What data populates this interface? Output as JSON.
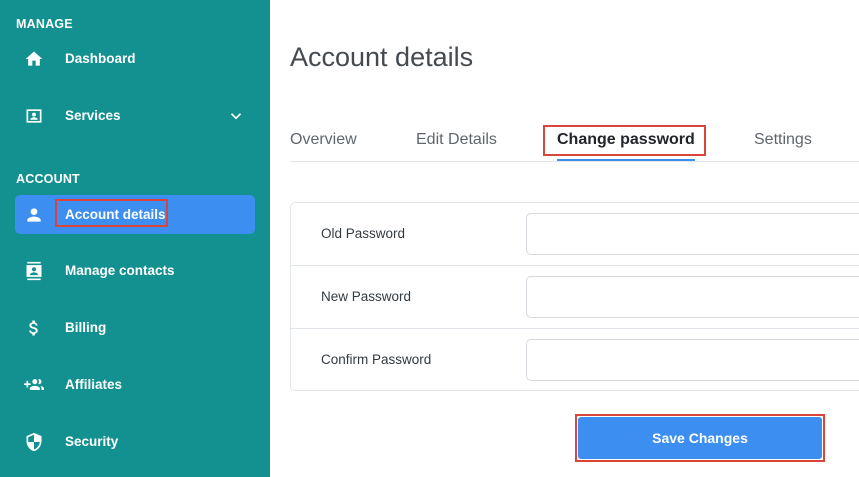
{
  "sidebar": {
    "manage_label": "MANAGE",
    "account_label": "ACCOUNT",
    "items": [
      {
        "label": "Dashboard",
        "icon": "home-icon"
      },
      {
        "label": "Services",
        "icon": "contact-card-icon"
      },
      {
        "label": "Account details",
        "icon": "person-icon"
      },
      {
        "label": "Manage contacts",
        "icon": "contacts-icon"
      },
      {
        "label": "Billing",
        "icon": "dollar-icon"
      },
      {
        "label": "Affiliates",
        "icon": "add-group-icon"
      },
      {
        "label": "Security",
        "icon": "shield-icon"
      }
    ],
    "active_item": "Account details"
  },
  "main": {
    "title": "Account details",
    "tabs": [
      {
        "label": "Overview"
      },
      {
        "label": "Edit Details"
      },
      {
        "label": "Change password"
      },
      {
        "label": "Settings"
      }
    ],
    "active_tab": "Change password",
    "form": {
      "fields": [
        {
          "label": "Old Password",
          "value": "",
          "placeholder": ""
        },
        {
          "label": "New Password",
          "value": "",
          "placeholder": ""
        },
        {
          "label": "Confirm Password",
          "value": "",
          "placeholder": ""
        }
      ],
      "submit_label": "Save Changes"
    }
  },
  "colors": {
    "sidebar_bg": "#139190",
    "accent": "#3c8ff0",
    "highlight_border": "#d9443b"
  }
}
